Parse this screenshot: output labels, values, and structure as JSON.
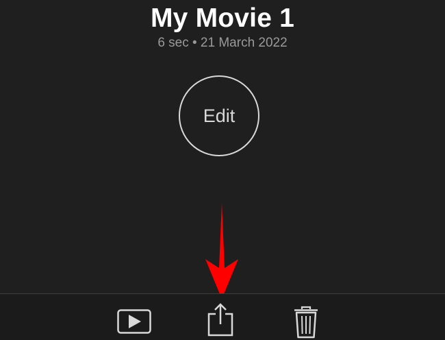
{
  "header": {
    "title": "My Movie 1",
    "subtitle": "6 sec • 21 March 2022"
  },
  "edit": {
    "label": "Edit"
  },
  "toolbar": {
    "items": [
      {
        "name": "play",
        "icon": "play-icon"
      },
      {
        "name": "share",
        "icon": "share-icon"
      },
      {
        "name": "delete",
        "icon": "trash-icon"
      }
    ]
  },
  "annotation": {
    "arrow_color": "#ff0000"
  },
  "colors": {
    "background": "#1f1f1f",
    "text": "#ffffff",
    "muted_text": "#9a9a9a",
    "icon": "#d9d9d9"
  }
}
